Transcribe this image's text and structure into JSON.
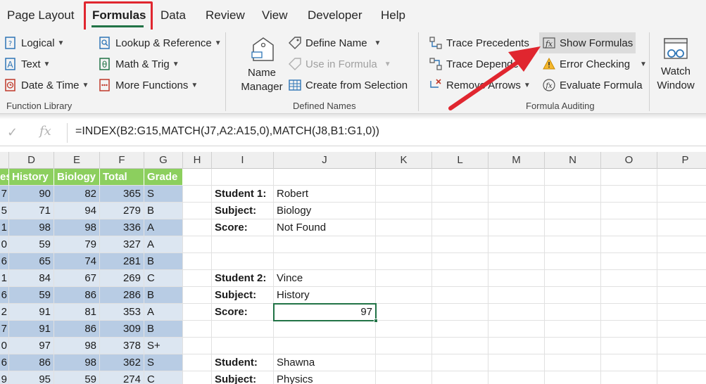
{
  "tabs": [
    {
      "label": "Page Layout",
      "active": false
    },
    {
      "label": "Formulas",
      "active": true
    },
    {
      "label": "Data",
      "active": false
    },
    {
      "label": "Review",
      "active": false
    },
    {
      "label": "View",
      "active": false
    },
    {
      "label": "Developer",
      "active": false
    },
    {
      "label": "Help",
      "active": false
    }
  ],
  "ribbon": {
    "function_library": {
      "group_label": "Function Library",
      "logical": "Logical",
      "text": "Text",
      "date_time": "Date & Time",
      "lookup_reference": "Lookup & Reference",
      "math_trig": "Math & Trig",
      "more_functions": "More Functions"
    },
    "defined_names": {
      "group_label": "Defined Names",
      "name_manager_line1": "Name",
      "name_manager_line2": "Manager",
      "define_name": "Define Name",
      "use_in_formula": "Use in Formula",
      "create_from_selection": "Create from Selection"
    },
    "formula_auditing": {
      "group_label": "Formula Auditing",
      "trace_precedents": "Trace Precedents",
      "trace_dependents": "Trace Dependents",
      "remove_arrows": "Remove Arrows",
      "show_formulas": "Show Formulas",
      "error_checking": "Error Checking",
      "evaluate_formula": "Evaluate Formula"
    },
    "watch_window": {
      "line1": "Watch",
      "line2": "Window"
    }
  },
  "formula_bar": {
    "check": "✓",
    "fx": "fx",
    "formula": "=INDEX(B2:G15,MATCH(J7,A2:A15,0),MATCH(J8,B1:G1,0))"
  },
  "columns": [
    "D",
    "E",
    "F",
    "G",
    "H",
    "I",
    "J",
    "K",
    "L",
    "M",
    "N",
    "O",
    "P"
  ],
  "table": {
    "headers": {
      "c": "es",
      "d": "History",
      "e": "Biology",
      "f": "Total",
      "g": "Grade"
    },
    "rows": [
      {
        "c": "7",
        "d": "90",
        "e": "82",
        "f": "365",
        "g": "S"
      },
      {
        "c": "5",
        "d": "71",
        "e": "94",
        "f": "279",
        "g": "B"
      },
      {
        "c": "1",
        "d": "98",
        "e": "98",
        "f": "336",
        "g": "A"
      },
      {
        "c": "0",
        "d": "59",
        "e": "79",
        "f": "327",
        "g": "A"
      },
      {
        "c": "6",
        "d": "65",
        "e": "74",
        "f": "281",
        "g": "B"
      },
      {
        "c": "1",
        "d": "84",
        "e": "67",
        "f": "269",
        "g": "C"
      },
      {
        "c": "6",
        "d": "59",
        "e": "86",
        "f": "286",
        "g": "B"
      },
      {
        "c": "2",
        "d": "91",
        "e": "81",
        "f": "353",
        "g": "A"
      },
      {
        "c": "7",
        "d": "91",
        "e": "86",
        "f": "309",
        "g": "B"
      },
      {
        "c": "0",
        "d": "97",
        "e": "98",
        "f": "378",
        "g": "S+"
      },
      {
        "c": "6",
        "d": "86",
        "e": "98",
        "f": "362",
        "g": "S"
      },
      {
        "c": "9",
        "d": "95",
        "e": "59",
        "f": "274",
        "g": "C"
      }
    ]
  },
  "lookups": {
    "block1": {
      "student_label": "Student 1:",
      "student": "Robert",
      "subject_label": "Subject:",
      "subject": "Biology",
      "score_label": "Score:",
      "score": "Not Found"
    },
    "block2": {
      "student_label": "Student 2:",
      "student": "Vince",
      "subject_label": "Subject:",
      "subject": "History",
      "score_label": "Score:",
      "score": "97"
    },
    "block3": {
      "student_label": "Student:",
      "student": "Shawna",
      "subject_label": "Subject:",
      "subject": "Physics"
    }
  },
  "colors": {
    "accent": "#217346",
    "highlight": "#e0262f",
    "header_green": "#8ccf5e",
    "band_dark": "#b8cce4",
    "band_light": "#dce6f1"
  }
}
